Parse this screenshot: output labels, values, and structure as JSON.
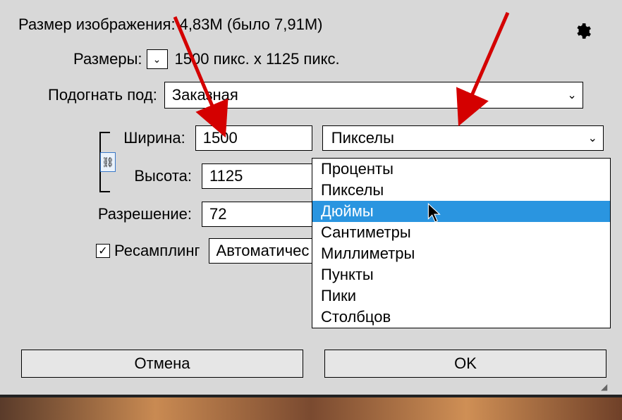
{
  "header": {
    "size_label": "Размер изображения:",
    "size_value": "4,83M (было 7,91M)"
  },
  "dimensions": {
    "label": "Размеры:",
    "value": "1500 пикс. x 1125 пикс."
  },
  "fit": {
    "label": "Подогнать под:",
    "value": "Заказная"
  },
  "width": {
    "label": "Ширина:",
    "value": "1500"
  },
  "height": {
    "label": "Высота:",
    "value": "1125"
  },
  "resolution": {
    "label": "Разрешение:",
    "value": "72"
  },
  "unit_selected": "Пикселы",
  "unit_options": [
    "Проценты",
    "Пикселы",
    "Дюймы",
    "Сантиметры",
    "Миллиметры",
    "Пункты",
    "Пики",
    "Столбцов"
  ],
  "unit_hover_index": 2,
  "resample": {
    "checked": true,
    "label": "Ресамплинг",
    "method": "Автоматичес"
  },
  "buttons": {
    "cancel": "Отмена",
    "ok": "OK"
  },
  "icons": {
    "chevron": "⌄",
    "check": "✓",
    "link": "⛓"
  }
}
